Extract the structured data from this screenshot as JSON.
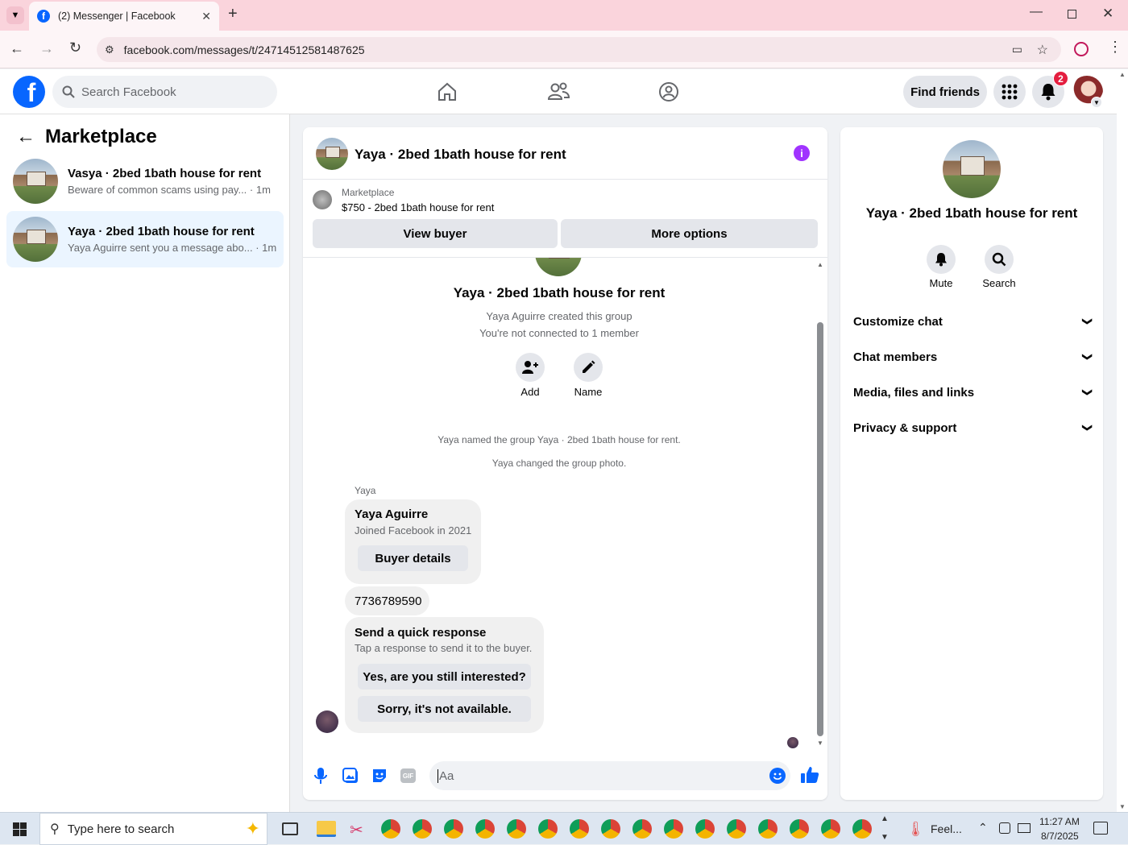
{
  "browser": {
    "tab_title": "(2) Messenger | Facebook",
    "url": "facebook.com/messages/t/24714512581487625"
  },
  "fb_header": {
    "search_placeholder": "Search Facebook",
    "find_friends": "Find friends",
    "notification_count": "2"
  },
  "left": {
    "title": "Marketplace",
    "threads": [
      {
        "name": "Vasya · 2bed 1bath house for rent",
        "preview": "Beware of common scams using pay...",
        "time": "· 1m"
      },
      {
        "name": "Yaya · 2bed 1bath house for rent",
        "preview": "Yaya Aguirre sent you a message abo...",
        "time": "· 1m"
      }
    ]
  },
  "chat": {
    "header_title": "Yaya · 2bed 1bath house for rent",
    "listing_source": "Marketplace",
    "listing_title": "$750 - 2bed 1bath house for rent",
    "view_buyer": "View buyer",
    "more_options": "More options",
    "group_title": "Yaya · 2bed 1bath house for rent",
    "created_text": "Yaya Aguirre created this group",
    "connected_text": "You're not connected to 1 member",
    "add_label": "Add",
    "name_label": "Name",
    "event1": "Yaya named the group Yaya · 2bed 1bath house for rent.",
    "event2": "Yaya changed the group photo.",
    "sender": "Yaya",
    "card_name": "Yaya Aguirre",
    "card_sub": "Joined Facebook in 2021",
    "buyer_details": "Buyer details",
    "phone": "7736789590",
    "qr_title": "Send a quick response",
    "qr_sub": "Tap a response to send it to the buyer.",
    "qr1": "Yes, are you still interested?",
    "qr2": "Sorry, it's not available.",
    "composer_placeholder": "Aa"
  },
  "right": {
    "title": "Yaya · 2bed 1bath house for rent",
    "mute": "Mute",
    "search": "Search",
    "sections": [
      "Customize chat",
      "Chat members",
      "Media, files and links",
      "Privacy & support"
    ]
  },
  "taskbar": {
    "search_placeholder": "Type here to search",
    "weather": "Feel...",
    "time": "11:27 AM",
    "date": "8/7/2025"
  },
  "colors": {
    "fb_blue": "#0866ff",
    "messenger_purple": "#a033ff",
    "badge_red": "#e41e3f"
  }
}
